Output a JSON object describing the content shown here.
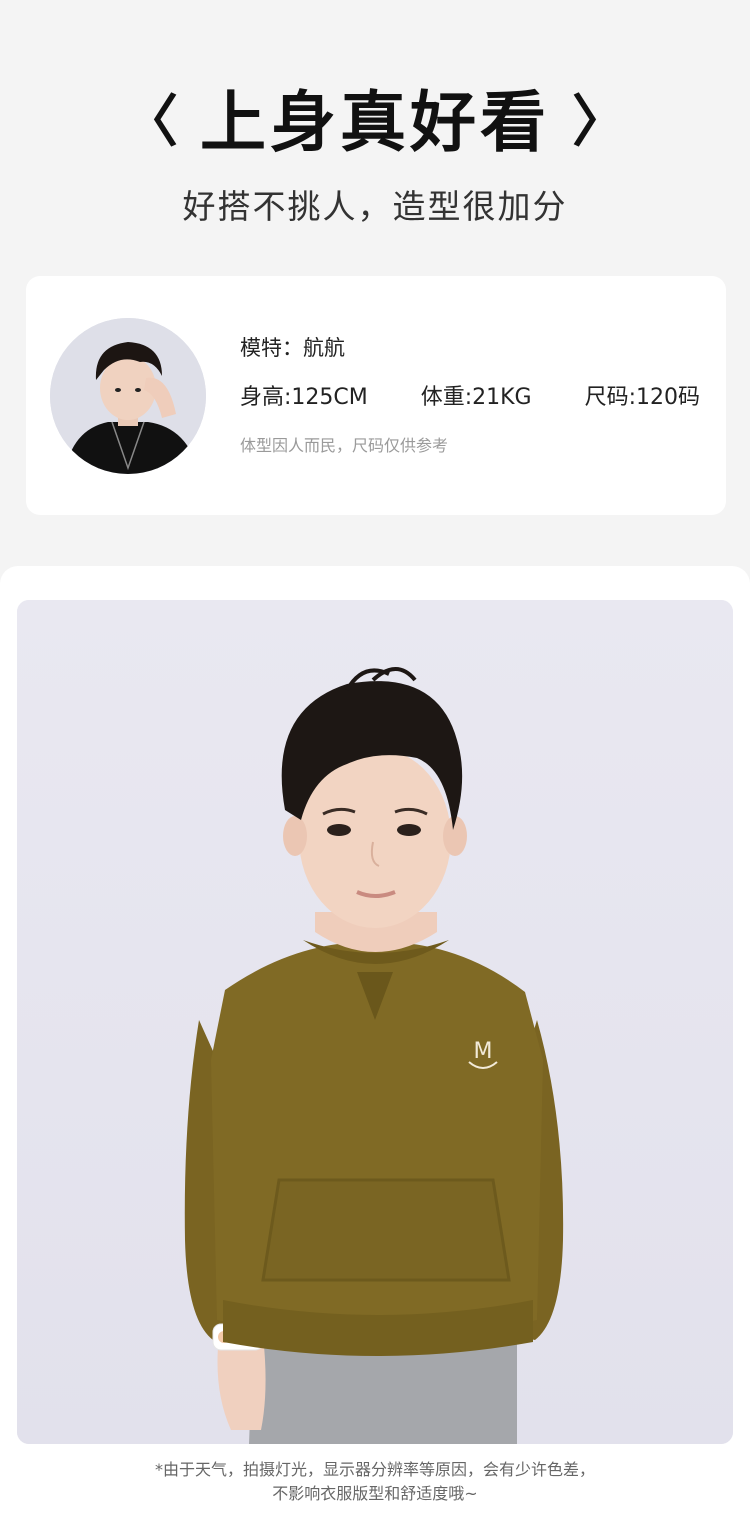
{
  "header": {
    "bracket_left": "〈",
    "title": "上身真好看",
    "bracket_right": "〉",
    "subtitle": "好搭不挑人，造型很加分"
  },
  "model": {
    "name": "模特：航航",
    "height": "身高:125CM",
    "weight": "体重:21KG",
    "size": "尺码:120码",
    "note": "体型因人而民，尺码仅供参考"
  },
  "photo": {
    "logo_letter": "M",
    "colors": {
      "background": "#e7e6f0",
      "sweatshirt": "#806a25",
      "pants": "#a5a7ab",
      "hair": "#1d1714",
      "skin": "#f2d4c2"
    }
  },
  "disclaimer": {
    "line1": "*由于天气，拍摄灯光，显示器分辨率等原因，会有少许色差，",
    "line2": "不影响衣服版型和舒适度哦~"
  }
}
